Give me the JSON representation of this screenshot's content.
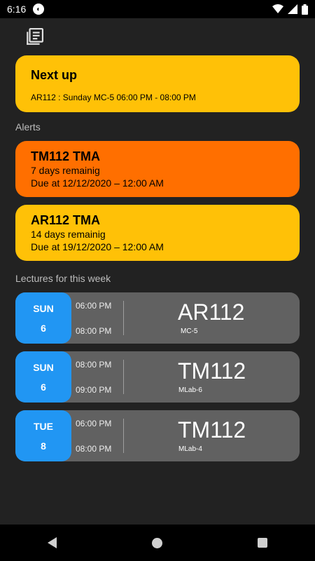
{
  "status": {
    "time": "6:16"
  },
  "next_up": {
    "title": "Next up",
    "detail": "AR112 : Sunday MC-5 06:00 PM - 08:00 PM"
  },
  "alerts_label": "Alerts",
  "alerts": [
    {
      "title": "TM112 TMA",
      "remaining": "7 days remainig",
      "due": "Due at 12/12/2020 – 12:00 AM",
      "color": "#FF6F00"
    },
    {
      "title": "AR112 TMA",
      "remaining": "14 days remainig",
      "due": "Due at 19/12/2020 – 12:00 AM",
      "color": "#FFC107"
    }
  ],
  "lectures_label": "Lectures for this week",
  "lectures": [
    {
      "day": "SUN",
      "date": "6",
      "start": "06:00 PM",
      "end": "08:00 PM",
      "course": "AR112",
      "room": "MC-5"
    },
    {
      "day": "SUN",
      "date": "6",
      "start": "08:00 PM",
      "end": "09:00 PM",
      "course": "TM112",
      "room": "MLab-6"
    },
    {
      "day": "TUE",
      "date": "8",
      "start": "06:00 PM",
      "end": "08:00 PM",
      "course": "TM112",
      "room": "MLab-4"
    }
  ],
  "colors": {
    "accent_yellow": "#FFC107",
    "accent_orange": "#FF6F00",
    "day_blue": "#2196F3",
    "lecture_gray": "#616161",
    "background": "#222222"
  }
}
